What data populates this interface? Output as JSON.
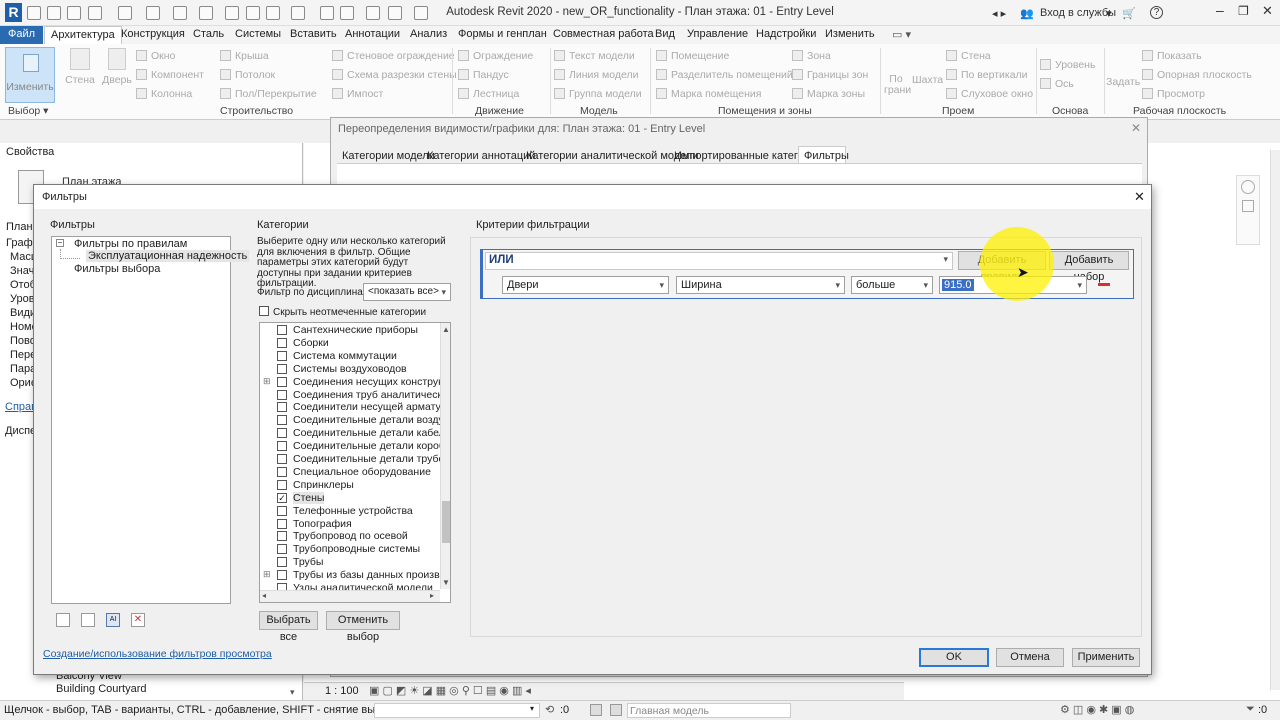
{
  "app": {
    "title": "Autodesk Revit 2020 - new_OR_functionality - План этажа: 01 - Entry Level",
    "signin": "Вход в службы",
    "help": "?"
  },
  "ribbon": {
    "tabs": [
      "Файл",
      "Архитектура",
      "Конструкция",
      "Сталь",
      "Системы",
      "Вставить",
      "Аннотации",
      "Анализ",
      "Формы и генплан",
      "Совместная работа",
      "Вид",
      "Управление",
      "Надстройки",
      "Изменить"
    ],
    "modify_label": "Изменить",
    "wall_label": "Стена",
    "door_label": "Дверь",
    "items_col1": [
      "Окно",
      "Компонент",
      "Колонна"
    ],
    "items_col2": [
      "Крыша",
      "Потолок",
      "Пол/Перекрытие"
    ],
    "items_col3": [
      "Стеновое ограждение",
      "Схема разрезки стены",
      "Импост"
    ],
    "items_col4": [
      "Ограждение",
      "Пандус",
      "Лестница"
    ],
    "items_col5": [
      "Текст модели",
      "Линия модели",
      "Группа модели"
    ],
    "items_col6": [
      "Помещение",
      "Разделитель помещений",
      "Марка помещения"
    ],
    "items_col7": [
      "Зона",
      "Границы зон",
      "Марка зоны"
    ],
    "opening_labels": [
      "По грани",
      "Шахта"
    ],
    "items_col8": [
      "Стена",
      "По вертикали",
      "Слуховое окно"
    ],
    "datum": [
      "Уровень",
      "Ось"
    ],
    "set_label": "Задать",
    "items_col9": [
      "Показать",
      "Опорная плоскость",
      "Просмотр"
    ],
    "groups": [
      "Выбор",
      "Строительство",
      "Движение",
      "Модель",
      "Помещения и зоны",
      "Проем",
      "Основа",
      "Рабочая плоскость"
    ]
  },
  "properties": {
    "header": "Свойства",
    "type": "План этажа",
    "rows": [
      "План э",
      "Графи",
      "Масш",
      "Значе",
      "Отоб",
      "Уров",
      "Види",
      "Номе",
      "Пово",
      "Пере",
      "Пара",
      "Ориє"
    ],
    "link": "Справ",
    "browser_header": "Диспе",
    "browser_items": [
      "Balcony View",
      "Building Courtyard"
    ]
  },
  "vg_dialog": {
    "title": "Переопределения видимости/графики для: План этажа: 01 - Entry Level",
    "tabs": [
      "Категории модели",
      "Категории аннотаций",
      "Категории аналитической модели",
      "Импортированные категории",
      "Фильтры"
    ]
  },
  "filters_dialog": {
    "title": "Фильтры",
    "filters_label": "Фильтры",
    "tree": {
      "rule_filters": "Фильтры по правилам",
      "rule_child": "Эксплуатационная надежность",
      "selection_filters": "Фильтры выбора"
    },
    "categories_label": "Категории",
    "categories_hint": "Выберите одну или несколько категорий для включения в фильтр. Общие параметры этих категорий будут доступны при задании критериев фильтрации.",
    "discipline_label": "Фильтр по дисциплинам:",
    "discipline_value": "<показать все>",
    "hide_unchecked": "Скрыть неотмеченные категории",
    "category_list": [
      {
        "label": "Сантехнические приборы",
        "checked": false,
        "expand": false
      },
      {
        "label": "Сборки",
        "checked": false,
        "expand": false
      },
      {
        "label": "Система коммутации",
        "checked": false,
        "expand": false
      },
      {
        "label": "Системы воздуховодов",
        "checked": false,
        "expand": false
      },
      {
        "label": "Соединения несущих конструкций",
        "checked": false,
        "expand": true
      },
      {
        "label": "Соединения труб аналитической мо",
        "checked": false,
        "expand": false
      },
      {
        "label": "Соединители несущей арматуры",
        "checked": false,
        "expand": false
      },
      {
        "label": "Соединительные детали воздухово",
        "checked": false,
        "expand": false
      },
      {
        "label": "Соединительные детали кабельных",
        "checked": false,
        "expand": false
      },
      {
        "label": "Соединительные детали коробов",
        "checked": false,
        "expand": false
      },
      {
        "label": "Соединительные детали трубопров",
        "checked": false,
        "expand": false
      },
      {
        "label": "Специальное оборудование",
        "checked": false,
        "expand": false
      },
      {
        "label": "Спринклеры",
        "checked": false,
        "expand": false
      },
      {
        "label": "Стены",
        "checked": true,
        "expand": false
      },
      {
        "label": "Телефонные устройства",
        "checked": false,
        "expand": false
      },
      {
        "label": "Топография",
        "checked": false,
        "expand": false
      },
      {
        "label": "Трубопровод по осевой",
        "checked": false,
        "expand": false
      },
      {
        "label": "Трубопроводные системы",
        "checked": false,
        "expand": false
      },
      {
        "label": "Трубы",
        "checked": false,
        "expand": false
      },
      {
        "label": "Трубы из базы данных производите",
        "checked": false,
        "expand": true
      },
      {
        "label": "Узлы аналитической модели",
        "checked": false,
        "expand": false
      }
    ],
    "select_all": "Выбрать все",
    "deselect_all": "Отменить выбор",
    "criteria_label": "Критерии фильтрации",
    "operator": "ИЛИ",
    "add_rule": "Добавить правило",
    "add_set": "Добавить набор",
    "rule": {
      "category": "Двери",
      "parameter": "Ширина",
      "condition": "больше",
      "value": "915.0"
    },
    "help_link": "Создание/использование фильтров просмотра",
    "ok": "OK",
    "cancel": "Отмена",
    "apply": "Применить"
  },
  "viewbar": {
    "scale": "1 : 100"
  },
  "statusbar": {
    "hint": "Щелчок - выбор, TAB - варианты, CTRL - добавление, SHIFT - снятие выбора.",
    "counter_left": ":0",
    "counter_right": ":0",
    "model": "Главная модель",
    "filter_count": ":0"
  },
  "colors": {
    "accent": "#2a6ab0",
    "rule_border": "#3a6fc4",
    "highlight": "#fff000"
  }
}
